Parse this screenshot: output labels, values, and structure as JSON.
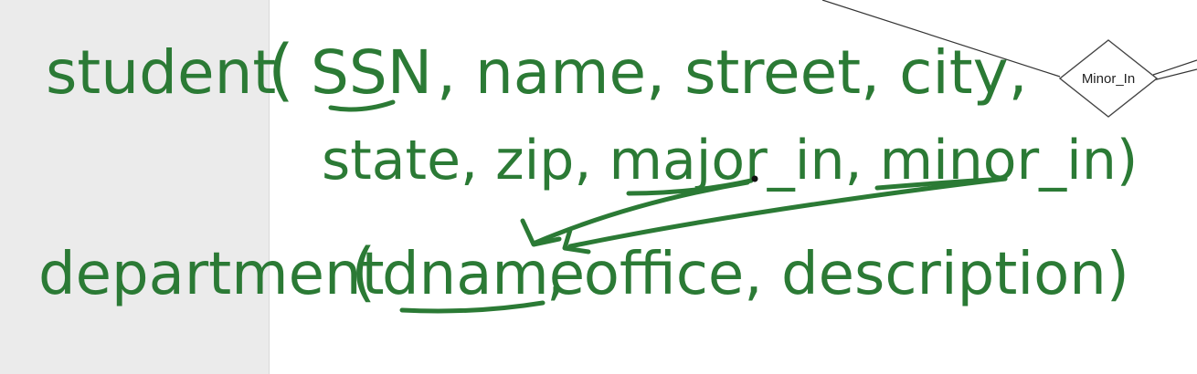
{
  "ink_color": "#2b7a35",
  "panel_color": "#ebebeb",
  "er_diagram": {
    "relationship_label": "Minor_In"
  },
  "schema": {
    "student": {
      "table_name": "student",
      "open_paren": "(",
      "key_attribute": "SSN",
      "line1_rest": ", name, street, city, ",
      "line2": "state, zip, major_in, minor_in)"
    },
    "department": {
      "table_name": "department",
      "open_paren": "(",
      "key_attribute": "dname",
      "rest": ", office, description)"
    }
  }
}
